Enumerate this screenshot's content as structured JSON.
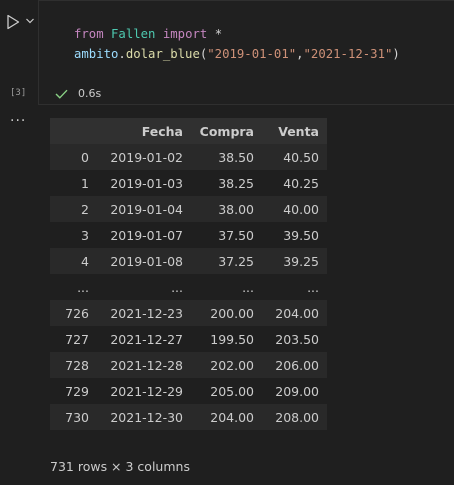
{
  "cell": {
    "execution_count": "[3]",
    "code_line1": {
      "kw_from": "from",
      "module": "Fallen",
      "kw_import": "import",
      "star": "*"
    },
    "code_line2": {
      "object": "ambito",
      "dot": ".",
      "function": "dolar_blue",
      "open": "(",
      "arg1": "\"2019-01-01\"",
      "comma": ",",
      "arg2": "\"2021-12-31\"",
      "close": ")"
    },
    "status_time": "0.6s",
    "status_color": "#89d185",
    "more_label": "..."
  },
  "table": {
    "headers": [
      "",
      "Fecha",
      "Compra",
      "Venta"
    ],
    "rows": [
      [
        "0",
        "2019-01-02",
        "38.50",
        "40.50"
      ],
      [
        "1",
        "2019-01-03",
        "38.25",
        "40.25"
      ],
      [
        "2",
        "2019-01-04",
        "38.00",
        "40.00"
      ],
      [
        "3",
        "2019-01-07",
        "37.50",
        "39.50"
      ],
      [
        "4",
        "2019-01-08",
        "37.25",
        "39.25"
      ],
      [
        "...",
        "...",
        "...",
        "..."
      ],
      [
        "726",
        "2021-12-23",
        "200.00",
        "204.00"
      ],
      [
        "727",
        "2021-12-27",
        "199.50",
        "203.50"
      ],
      [
        "728",
        "2021-12-28",
        "202.00",
        "206.00"
      ],
      [
        "729",
        "2021-12-29",
        "205.00",
        "209.00"
      ],
      [
        "730",
        "2021-12-30",
        "204.00",
        "208.00"
      ]
    ],
    "footer": "731 rows × 3 columns"
  }
}
